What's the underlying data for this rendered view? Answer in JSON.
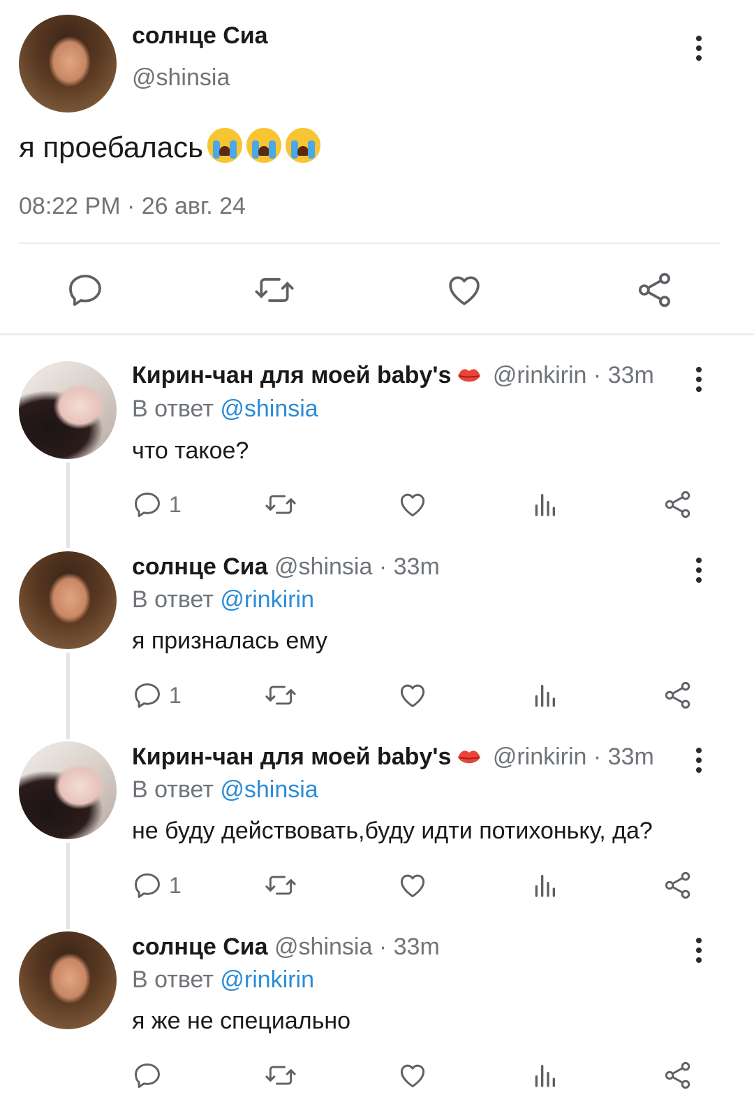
{
  "main_tweet": {
    "display_name": "солнце Сиа",
    "handle": "@shinsia",
    "text": "я проебалась",
    "emojis": [
      "loudly-crying-face",
      "loudly-crying-face",
      "loudly-crying-face"
    ],
    "timestamp": "08:22 PM · 26 авг. 24"
  },
  "replies": [
    {
      "display_name": "Кирин-чан для моей baby's",
      "name_emoji": "kiss-mark",
      "handle": "@rinkirin",
      "time": "· 33m",
      "reply_prefix": "В ответ",
      "reply_to": "@shinsia",
      "text": "что такое?",
      "reply_count": "1"
    },
    {
      "display_name": "солнце Сиа",
      "handle": "@shinsia",
      "time": "· 33m",
      "reply_prefix": "В ответ",
      "reply_to": "@rinkirin",
      "text": "я призналась ему",
      "reply_count": "1"
    },
    {
      "display_name": "Кирин-чан для моей baby's",
      "name_emoji": "kiss-mark",
      "handle": "@rinkirin",
      "time": "· 33m",
      "reply_prefix": "В ответ",
      "reply_to": "@shinsia",
      "text": "не буду действовать,буду идти потихоньку, да?",
      "reply_count": "1"
    },
    {
      "display_name": "солнце Сиа",
      "handle": "@shinsia",
      "time": "· 33m",
      "reply_prefix": "В ответ",
      "reply_to": "@rinkirin",
      "text": "я же не специально",
      "reply_count": ""
    }
  ],
  "colors": {
    "link": "#2a8cd8",
    "secondary_text": "#6f7479",
    "lips": "#e8443a"
  }
}
